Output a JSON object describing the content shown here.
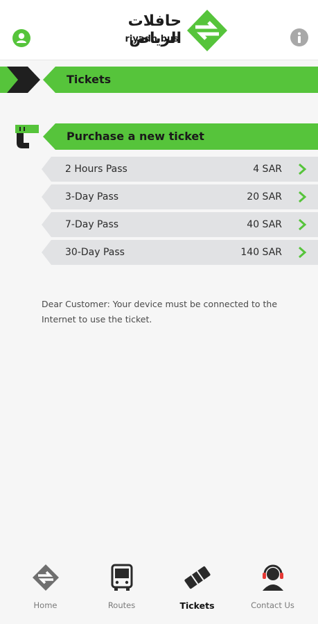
{
  "colors": {
    "brand_green": "#56c43b",
    "dark": "#1f1f1f",
    "row_bg": "#e1e2e4",
    "icon_gray": "#a8a8a8"
  },
  "header": {
    "logo_arabic": "حافلات الرياض",
    "logo_english": "riyadh bus",
    "icons": {
      "left": "user-icon",
      "right": "info-icon"
    }
  },
  "section": {
    "title": "Tickets"
  },
  "purchase": {
    "title": "Purchase a new ticket",
    "icon": "ticket-hand-icon",
    "tickets": [
      {
        "name": "2 Hours Pass",
        "price": "4 SAR"
      },
      {
        "name": "3-Day Pass",
        "price": "20 SAR"
      },
      {
        "name": "7-Day Pass",
        "price": "40 SAR"
      },
      {
        "name": "30-Day Pass",
        "price": "140 SAR"
      }
    ]
  },
  "notice": "Dear Customer: Your device must be connected to the Internet to use the ticket.",
  "nav": {
    "active": "Tickets",
    "items": [
      {
        "label": "Home",
        "icon": "home-logo-icon"
      },
      {
        "label": "Routes",
        "icon": "bus-icon"
      },
      {
        "label": "Tickets",
        "icon": "tickets-icon"
      },
      {
        "label": "Contact Us",
        "icon": "headset-icon"
      }
    ]
  }
}
